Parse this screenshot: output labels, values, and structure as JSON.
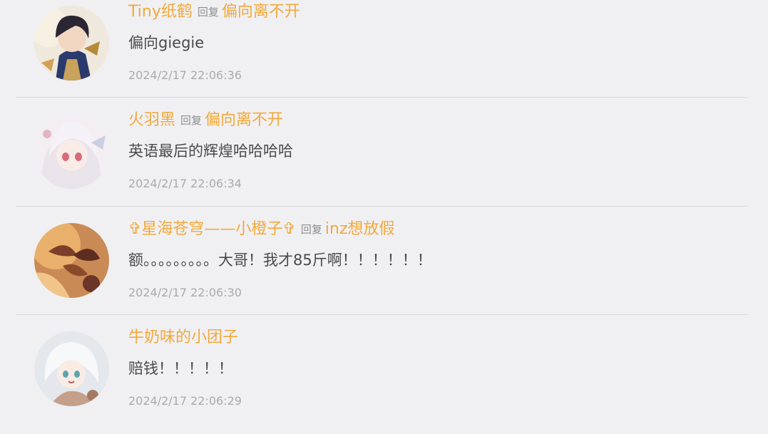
{
  "comments": [
    {
      "author": "Tiny纸鹤",
      "reply_label": "回复",
      "reply_to": "偏向离不开",
      "text": "偏向giegie",
      "timestamp": "2024/2/17 22:06:36",
      "avatar_colors": [
        "#2c2a3a",
        "#c9b07a",
        "#f3e6d3"
      ]
    },
    {
      "author": "火羽黑",
      "reply_label": "回复",
      "reply_to": "偏向离不开",
      "text": "英语最后的辉煌哈哈哈哈",
      "timestamp": "2024/2/17 22:06:34",
      "avatar_colors": [
        "#f5f0f4",
        "#e3b8c4",
        "#d8dbe8"
      ]
    },
    {
      "author": "✞星海苍穹——小橙子✞",
      "reply_label": "回复",
      "reply_to": "inz想放假",
      "text": "额。。。。。。。。。大哥！我才85斤啊！！！！！！",
      "timestamp": "2024/2/17 22:06:30",
      "avatar_colors": [
        "#b9794a",
        "#e2a05a",
        "#6b3a2a"
      ]
    },
    {
      "author": "牛奶味的小团子",
      "reply_label": "",
      "reply_to": "",
      "text": "赔钱！！！！！",
      "timestamp": "2024/2/17 22:06:29",
      "avatar_colors": [
        "#e8eaee",
        "#9fc6cf",
        "#caa68a"
      ]
    }
  ]
}
